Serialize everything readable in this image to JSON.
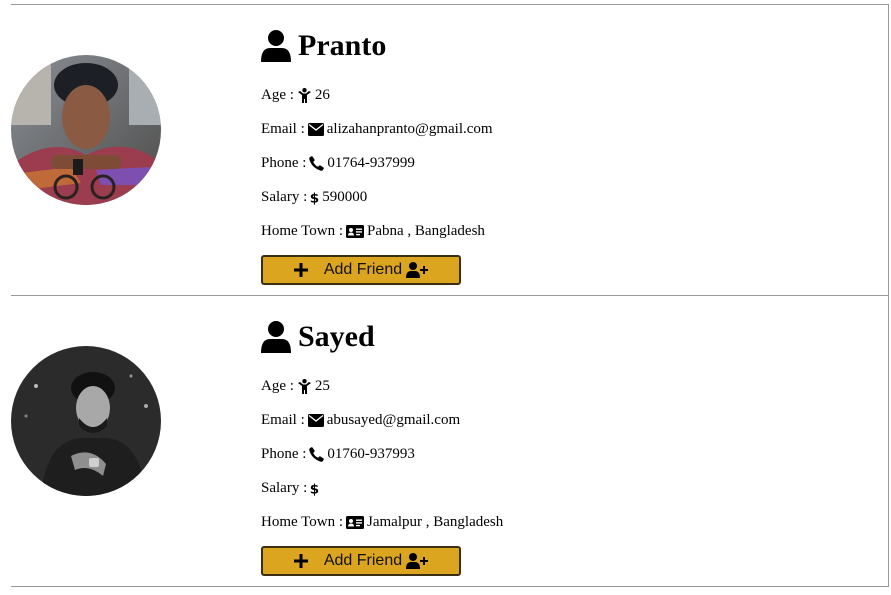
{
  "profiles": [
    {
      "name": "Pranto",
      "age_label": "Age :",
      "age": "26",
      "email_label": "Email :",
      "email": "alizahanpranto@gmail.com",
      "phone_label": "Phone :",
      "phone": "01764-937999",
      "salary_label": "Salary :",
      "salary": "590000",
      "town_label": "Home Town :",
      "town": "Pabna , Bangladesh",
      "button_label": "Add Friend",
      "avatar_style": "color-photo"
    },
    {
      "name": "Sayed",
      "age_label": "Age :",
      "age": "25",
      "email_label": "Email :",
      "email": "abusayed@gmail.com",
      "phone_label": "Phone :",
      "phone": "01760-937993",
      "salary_label": "Salary :",
      "salary": "",
      "town_label": "Home Town :",
      "town": "Jamalpur , Bangladesh",
      "button_label": "Add Friend",
      "avatar_style": "grayscale-photo"
    }
  ],
  "icons": {
    "name": "user-icon",
    "age": "child-icon",
    "email": "envelope-icon",
    "phone": "phone-icon",
    "salary": "dollar-icon",
    "town": "id-card-icon",
    "button_left": "plus-icon",
    "button_right": "user-plus-icon"
  },
  "colors": {
    "button_bg": "#dba520",
    "button_border": "#3a2f12",
    "divider": "#999999"
  }
}
